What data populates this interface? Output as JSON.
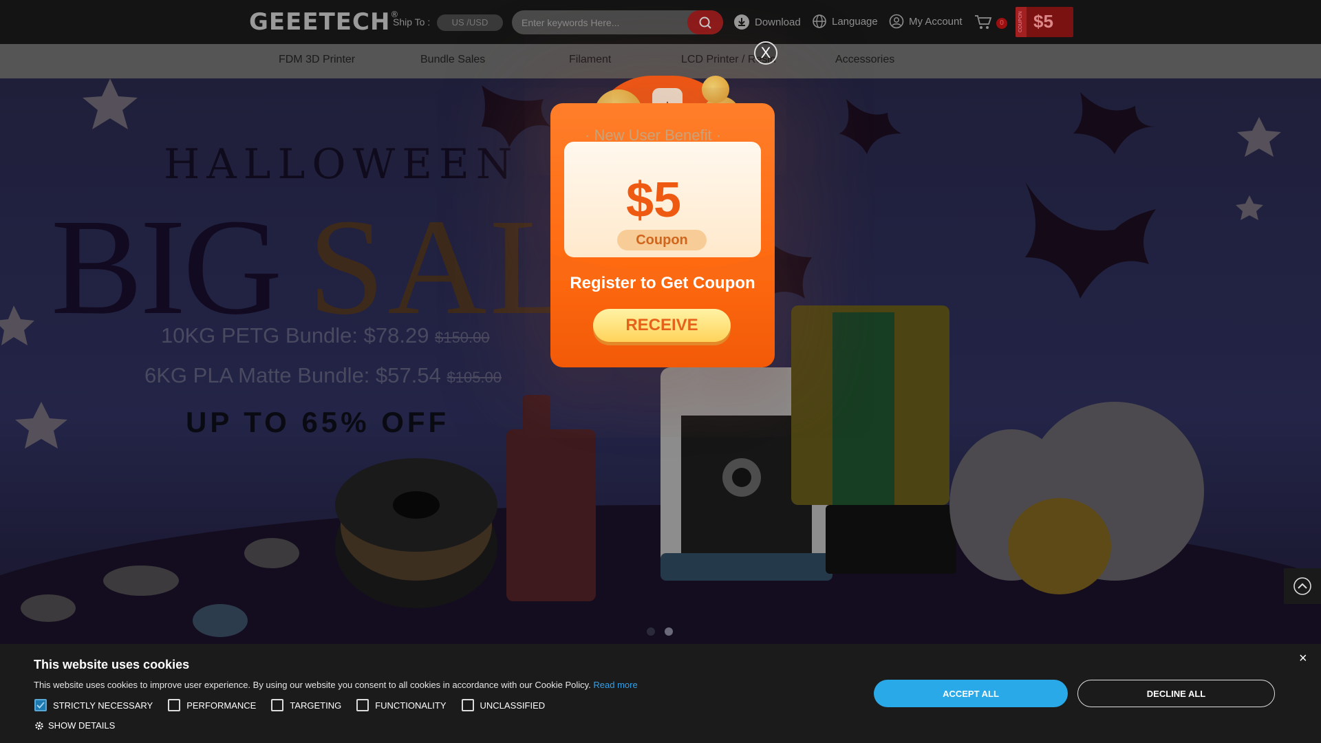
{
  "header": {
    "logo": "GEEETECH",
    "logo_mark": "®",
    "ship_to_label": "Ship To :",
    "ship_to_value": "US /USD",
    "search_placeholder": "Enter keywords Here...",
    "download": "Download",
    "language": "Language",
    "my_account": "My Account",
    "cart_count": "0",
    "coupon_side": "COUPON",
    "coupon_amount": "$5"
  },
  "nav": {
    "items": [
      "FDM 3D Printer",
      "Bundle Sales",
      "Filament",
      "LCD Printer / Resin",
      "Accessories"
    ]
  },
  "hero": {
    "halloween": "HALLOWEEN",
    "big": "BIG",
    "sale": "SALE",
    "promo1_text": "10KG PETG Bundle: $78.29",
    "promo1_old": "$150.00",
    "promo2_text": "6KG PLA Matte Bundle: $57.54",
    "promo2_old": "$105.00",
    "discount": "UP TO 65% OFF",
    "slide_count": 2,
    "active_slide": 2
  },
  "popup": {
    "close": "X",
    "benefit": "· New User Benefit ·",
    "amount": "$5",
    "coupon_label": "Coupon",
    "register": "Register to Get Coupon",
    "receive": "RECEIVE",
    "bag_symbol": "$"
  },
  "cookie": {
    "title": "This website uses cookies",
    "text": "This website uses cookies to improve user experience. By using our website you consent to all cookies in accordance with our Cookie Policy.",
    "read_more": "Read more",
    "options": [
      {
        "label": "STRICTLY NECESSARY",
        "checked": true
      },
      {
        "label": "PERFORMANCE",
        "checked": false
      },
      {
        "label": "TARGETING",
        "checked": false
      },
      {
        "label": "FUNCTIONALITY",
        "checked": false
      },
      {
        "label": "UNCLASSIFIED",
        "checked": false
      }
    ],
    "show_details": "SHOW DETAILS",
    "accept": "ACCEPT ALL",
    "decline": "DECLINE ALL",
    "close": "×"
  },
  "colors": {
    "accent_blue": "#2aa9e8",
    "popup_orange": "#ff6a10",
    "brand_red": "#8e1a1a"
  }
}
